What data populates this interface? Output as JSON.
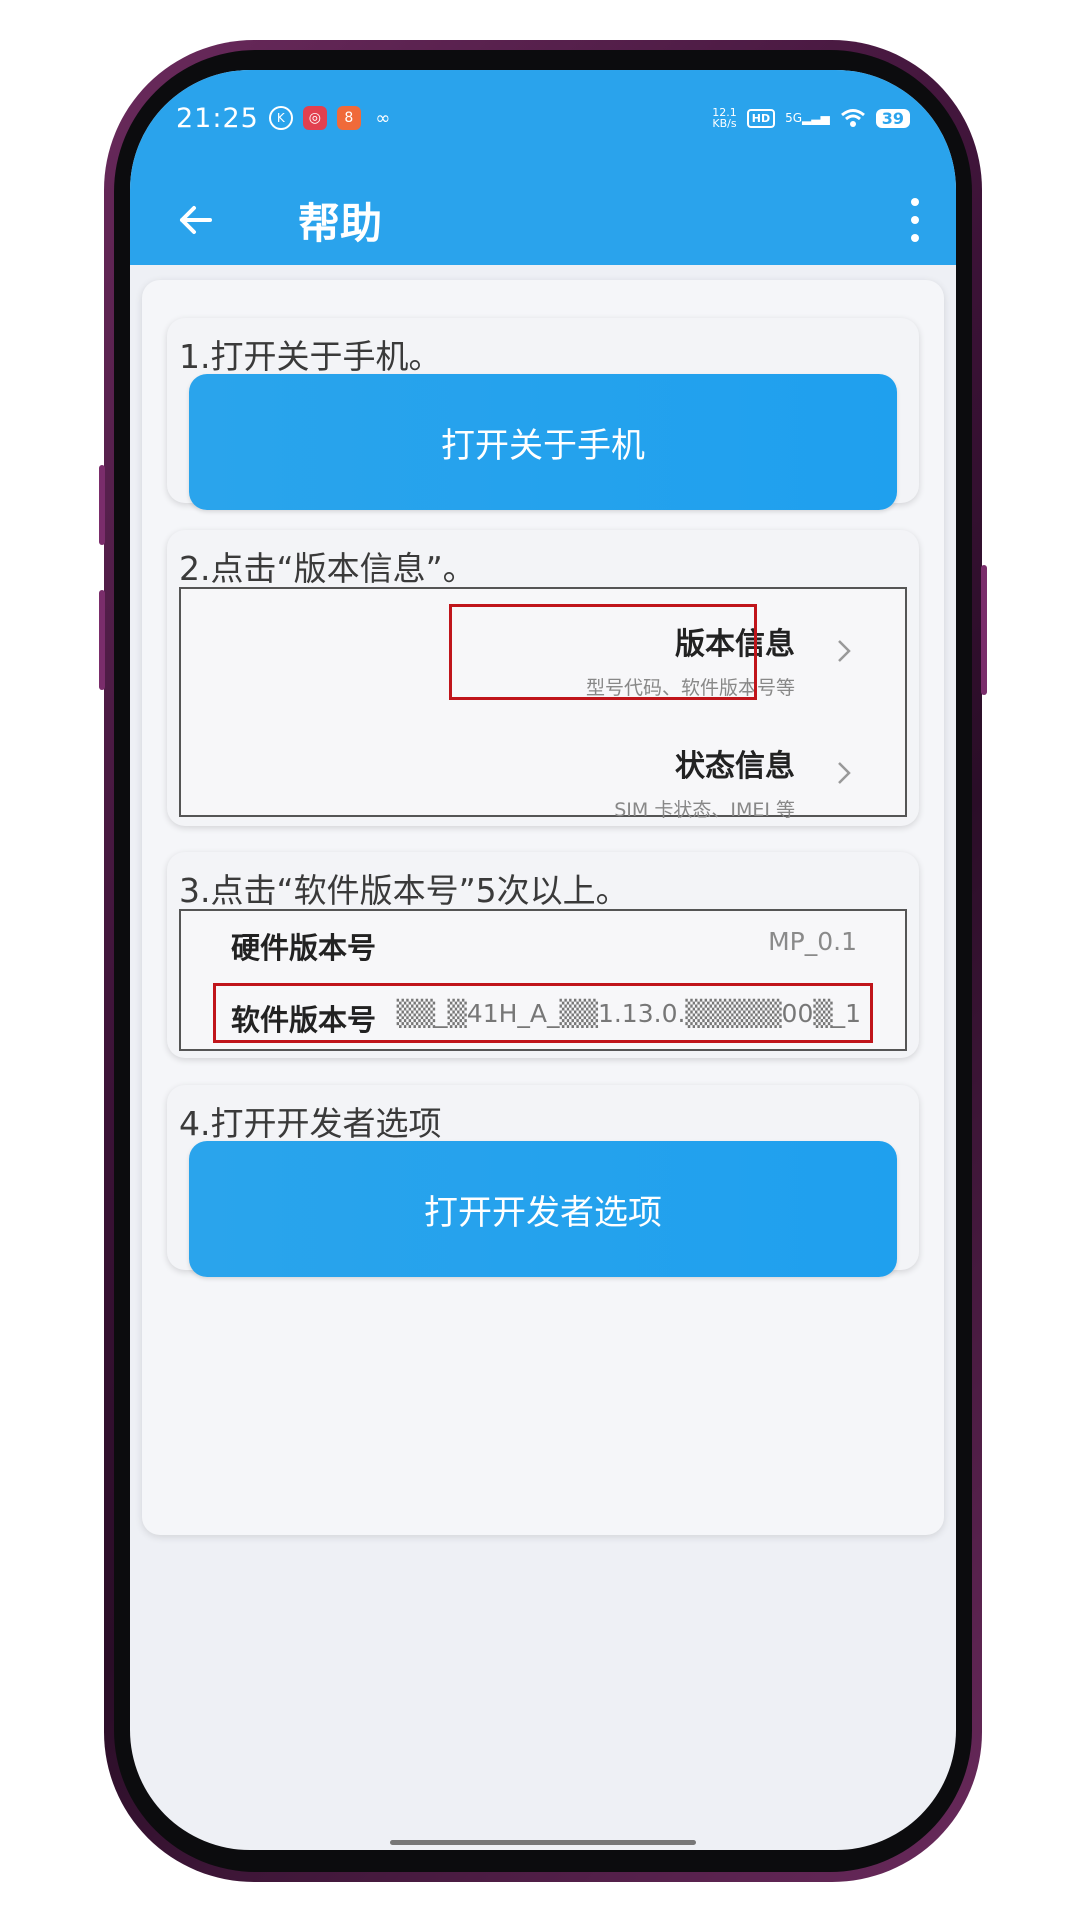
{
  "status_bar": {
    "time": "21:25",
    "net_speed_value": "12.1",
    "net_speed_unit": "KB/s",
    "hd": "HD",
    "network": "5G",
    "battery": "39"
  },
  "app_bar": {
    "title": "帮助"
  },
  "steps": [
    {
      "text": "1.打开关于手机。",
      "button": "打开关于手机"
    },
    {
      "text": "2.点击“版本信息”。"
    },
    {
      "text": "3.点击“软件版本号”5次以上。"
    },
    {
      "text": "4.打开开发者选项",
      "button": "打开开发者选项"
    }
  ],
  "about_menu": {
    "version_info": {
      "title": "版本信息",
      "subtitle": "型号代码、软件版本号等"
    },
    "status_info": {
      "title": "状态信息",
      "subtitle": "SIM 卡状态、IMEI 等"
    }
  },
  "version_rows": {
    "hardware": {
      "label": "硬件版本号",
      "value": "MP_0.1"
    },
    "software": {
      "label": "软件版本号",
      "value": "▒▒_▒41H_A_▒▒1.13.0.▒▒▒▒▒00▒_1"
    }
  },
  "colors": {
    "accent": "#2aa3ec",
    "highlight": "#c0151b"
  }
}
